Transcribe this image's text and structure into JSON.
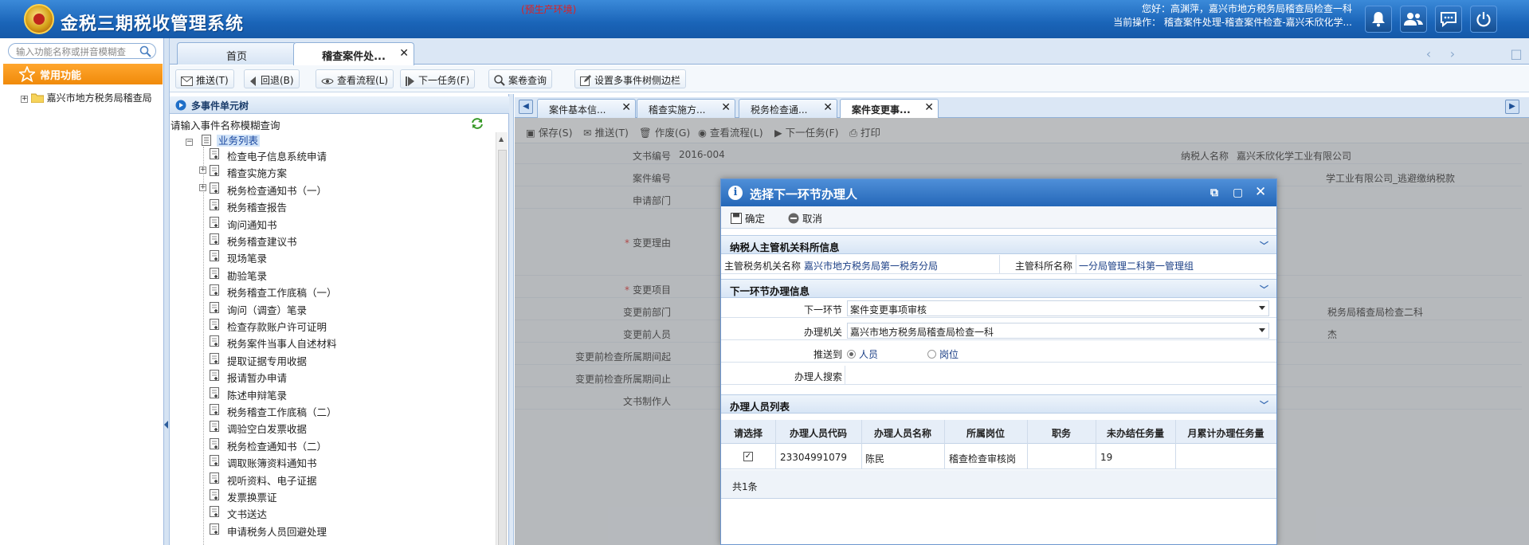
{
  "header": {
    "title": "金税三期税收管理系统",
    "env": "(预生产环境)",
    "greeting": "您好：高渊萍，嘉兴市地方税务局稽查局检查一科",
    "current_op": "当前操作： 稽查案件处理-稽查案件检查-嘉兴禾欣化学...",
    "icons": [
      "bell-icon",
      "users-icon",
      "chat-icon",
      "power-icon"
    ]
  },
  "left": {
    "search_placeholder": "输入功能名称或拼音模糊查",
    "favorites": "常用功能",
    "tree_root": "嘉兴市地方税务局稽查局"
  },
  "main_tabs": [
    {
      "label": "首页"
    },
    {
      "label": "稽查案件处..."
    }
  ],
  "toolbar": {
    "push": "推送(T)",
    "back": "回退(B)",
    "flow": "查看流程(L)",
    "next": "下一任务(F)",
    "query": "案卷查询",
    "setting": "设置多事件树侧边栏"
  },
  "tree": {
    "header": "多事件单元树",
    "query": "请输入事件名称模糊查询",
    "root": "业务列表",
    "items": [
      "检查电子信息系统申请",
      "稽查实施方案",
      "税务检查通知书（一）",
      "税务稽查报告",
      "询问通知书",
      "税务稽查建议书",
      "现场笔录",
      "勘验笔录",
      "税务稽查工作底稿（一）",
      "询问（调查）笔录",
      "检查存款账户许可证明",
      "税务案件当事人自述材料",
      "提取证据专用收据",
      "报请暂办申请",
      "陈述申辩笔录",
      "税务稽查工作底稿（二）",
      "调验空白发票收据",
      "税务检查通知书（二）",
      "调取账簿资料通知书",
      "视听资料、电子证据",
      "发票换票证",
      "文书送达",
      "申请税务人员回避处理"
    ]
  },
  "right_tabs": [
    {
      "label": "案件基本信..."
    },
    {
      "label": "稽查实施方..."
    },
    {
      "label": "税务检查通..."
    },
    {
      "label": "案件变更事..."
    }
  ],
  "form": {
    "tools": [
      "保存(S)",
      "推送(T)",
      "作废(G)",
      "查看流程(L)",
      "下一任务(F)",
      "打印"
    ],
    "doc_no_label": "文书编号",
    "doc_no": "2016-004",
    "taxpayer_label": "纳税人名称",
    "taxpayer": "嘉兴禾欣化学工业有限公司",
    "case_no_label": "案件编号",
    "case_no_tail": "学工业有限公司_逃避缴纳税款",
    "apply_dept_label": "申请部门",
    "change_reason_label": "变更理由",
    "change_item_label": "变更项目",
    "before_dept_label": "变更前部门",
    "before_dept_tail": "税务局稽查局检查二科",
    "before_person_label": "变更前人员",
    "before_person_tail": "杰",
    "before_start_label": "变更前检查所属期间起",
    "before_end_label": "变更前检查所属期间止",
    "maker_label": "文书制作人"
  },
  "dialog": {
    "title": "选择下一环节办理人",
    "ok": "确定",
    "cancel": "取消",
    "sec1": "纳税人主管机关科所信息",
    "org_label": "主管税务机关名称",
    "org": "嘉兴市地方税务局第一税务分局",
    "section_label": "主管科所名称",
    "section": "一分局管理二科第一管理组",
    "sec2": "下一环节办理信息",
    "next_label": "下一环节",
    "next_value": "案件变更事项审核",
    "agency_label": "办理机关",
    "agency_value": "嘉兴市地方税务局稽查局检查一科",
    "push_label": "推送到",
    "radio_person": "人员",
    "radio_post": "岗位",
    "search_label": "办理人搜索",
    "sec3": "办理人员列表",
    "columns": [
      "请选择",
      "办理人员代码",
      "办理人员名称",
      "所属岗位",
      "职务",
      "未办结任务量",
      "月累计办理任务量"
    ],
    "rows": [
      {
        "code": "23304991079",
        "name": "陈民",
        "post": "稽查检查审核岗",
        "duty": "",
        "pending": "19",
        "monthly": ""
      }
    ],
    "total": "共1条"
  }
}
